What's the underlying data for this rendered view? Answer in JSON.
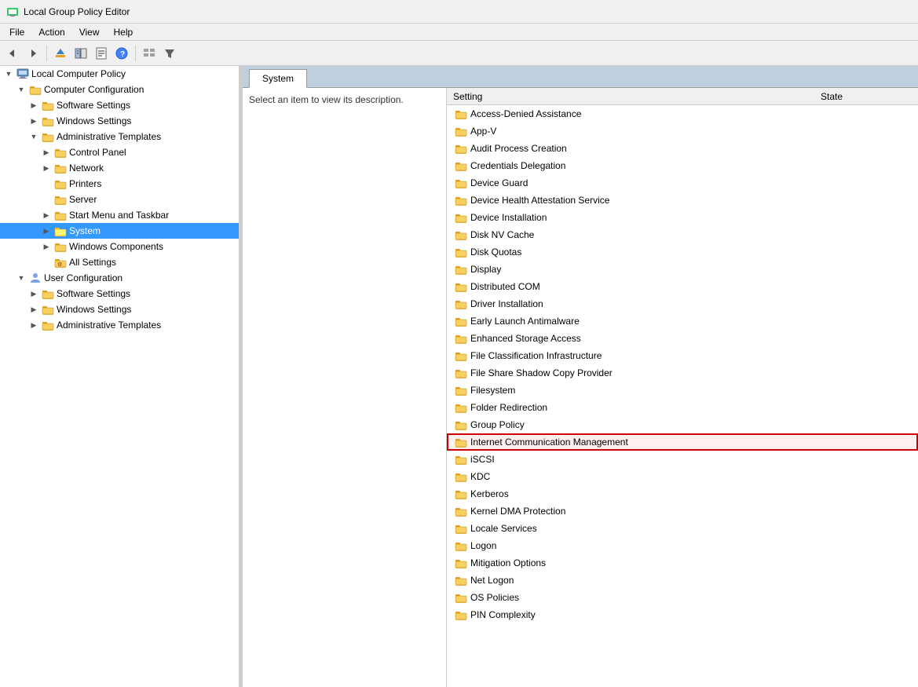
{
  "window": {
    "title": "Local Group Policy Editor",
    "icon": "gpedit-icon"
  },
  "menu": {
    "items": [
      "File",
      "Action",
      "View",
      "Help"
    ]
  },
  "toolbar": {
    "buttons": [
      {
        "name": "back-button",
        "icon": "◄",
        "label": "Back"
      },
      {
        "name": "forward-button",
        "icon": "►",
        "label": "Forward"
      },
      {
        "name": "up-button",
        "icon": "⬆",
        "label": "Up"
      },
      {
        "name": "show-hide-button",
        "icon": "📋",
        "label": "Show/Hide"
      },
      {
        "name": "properties-button",
        "icon": "📄",
        "label": "Properties"
      },
      {
        "name": "help-button",
        "icon": "?",
        "label": "Help"
      },
      {
        "name": "view-button",
        "icon": "⊞",
        "label": "View"
      },
      {
        "name": "filter-button",
        "icon": "▽",
        "label": "Filter"
      }
    ]
  },
  "tree": {
    "items": [
      {
        "id": "local-computer-policy",
        "label": "Local Computer Policy",
        "indent": 0,
        "expanded": true,
        "type": "computer",
        "expandable": true
      },
      {
        "id": "computer-configuration",
        "label": "Computer Configuration",
        "indent": 1,
        "expanded": true,
        "type": "folder",
        "expandable": true
      },
      {
        "id": "software-settings",
        "label": "Software Settings",
        "indent": 2,
        "expanded": false,
        "type": "folder",
        "expandable": true
      },
      {
        "id": "windows-settings",
        "label": "Windows Settings",
        "indent": 2,
        "expanded": false,
        "type": "folder",
        "expandable": true
      },
      {
        "id": "administrative-templates",
        "label": "Administrative Templates",
        "indent": 2,
        "expanded": true,
        "type": "folder",
        "expandable": true
      },
      {
        "id": "control-panel",
        "label": "Control Panel",
        "indent": 3,
        "expanded": false,
        "type": "folder",
        "expandable": true
      },
      {
        "id": "network",
        "label": "Network",
        "indent": 3,
        "expanded": false,
        "type": "folder",
        "expandable": true
      },
      {
        "id": "printers",
        "label": "Printers",
        "indent": 3,
        "expanded": false,
        "type": "folder",
        "expandable": false
      },
      {
        "id": "server",
        "label": "Server",
        "indent": 3,
        "expanded": false,
        "type": "folder",
        "expandable": false
      },
      {
        "id": "start-menu-taskbar",
        "label": "Start Menu and Taskbar",
        "indent": 3,
        "expanded": false,
        "type": "folder",
        "expandable": true
      },
      {
        "id": "system",
        "label": "System",
        "indent": 3,
        "expanded": false,
        "type": "folder-selected",
        "expandable": true,
        "selected": true
      },
      {
        "id": "windows-components",
        "label": "Windows Components",
        "indent": 3,
        "expanded": false,
        "type": "folder",
        "expandable": true
      },
      {
        "id": "all-settings",
        "label": "All Settings",
        "indent": 3,
        "expanded": false,
        "type": "settings",
        "expandable": false
      },
      {
        "id": "user-configuration",
        "label": "User Configuration",
        "indent": 1,
        "expanded": true,
        "type": "folder",
        "expandable": true
      },
      {
        "id": "user-software-settings",
        "label": "Software Settings",
        "indent": 2,
        "expanded": false,
        "type": "folder",
        "expandable": true
      },
      {
        "id": "user-windows-settings",
        "label": "Windows Settings",
        "indent": 2,
        "expanded": false,
        "type": "folder",
        "expandable": true
      },
      {
        "id": "user-administrative-templates",
        "label": "Administrative Templates",
        "indent": 2,
        "expanded": false,
        "type": "folder",
        "expandable": true
      }
    ]
  },
  "right_panel": {
    "tab_label": "System",
    "description": "Select an item to view its description.",
    "col_setting": "Setting",
    "col_state": "State",
    "items": [
      {
        "name": "Access-Denied Assistance",
        "state": "",
        "highlighted": false
      },
      {
        "name": "App-V",
        "state": "",
        "highlighted": false
      },
      {
        "name": "Audit Process Creation",
        "state": "",
        "highlighted": false
      },
      {
        "name": "Credentials Delegation",
        "state": "",
        "highlighted": false
      },
      {
        "name": "Device Guard",
        "state": "",
        "highlighted": false
      },
      {
        "name": "Device Health Attestation Service",
        "state": "",
        "highlighted": false
      },
      {
        "name": "Device Installation",
        "state": "",
        "highlighted": false
      },
      {
        "name": "Disk NV Cache",
        "state": "",
        "highlighted": false
      },
      {
        "name": "Disk Quotas",
        "state": "",
        "highlighted": false
      },
      {
        "name": "Display",
        "state": "",
        "highlighted": false
      },
      {
        "name": "Distributed COM",
        "state": "",
        "highlighted": false
      },
      {
        "name": "Driver Installation",
        "state": "",
        "highlighted": false
      },
      {
        "name": "Early Launch Antimalware",
        "state": "",
        "highlighted": false
      },
      {
        "name": "Enhanced Storage Access",
        "state": "",
        "highlighted": false
      },
      {
        "name": "File Classification Infrastructure",
        "state": "",
        "highlighted": false
      },
      {
        "name": "File Share Shadow Copy Provider",
        "state": "",
        "highlighted": false
      },
      {
        "name": "Filesystem",
        "state": "",
        "highlighted": false
      },
      {
        "name": "Folder Redirection",
        "state": "",
        "highlighted": false
      },
      {
        "name": "Group Policy",
        "state": "",
        "highlighted": false
      },
      {
        "name": "Internet Communication Management",
        "state": "",
        "highlighted": true
      },
      {
        "name": "iSCSI",
        "state": "",
        "highlighted": false
      },
      {
        "name": "KDC",
        "state": "",
        "highlighted": false
      },
      {
        "name": "Kerberos",
        "state": "",
        "highlighted": false
      },
      {
        "name": "Kernel DMA Protection",
        "state": "",
        "highlighted": false
      },
      {
        "name": "Locale Services",
        "state": "",
        "highlighted": false
      },
      {
        "name": "Logon",
        "state": "",
        "highlighted": false
      },
      {
        "name": "Mitigation Options",
        "state": "",
        "highlighted": false
      },
      {
        "name": "Net Logon",
        "state": "",
        "highlighted": false
      },
      {
        "name": "OS Policies",
        "state": "",
        "highlighted": false
      },
      {
        "name": "PIN Complexity",
        "state": "",
        "highlighted": false
      }
    ]
  }
}
